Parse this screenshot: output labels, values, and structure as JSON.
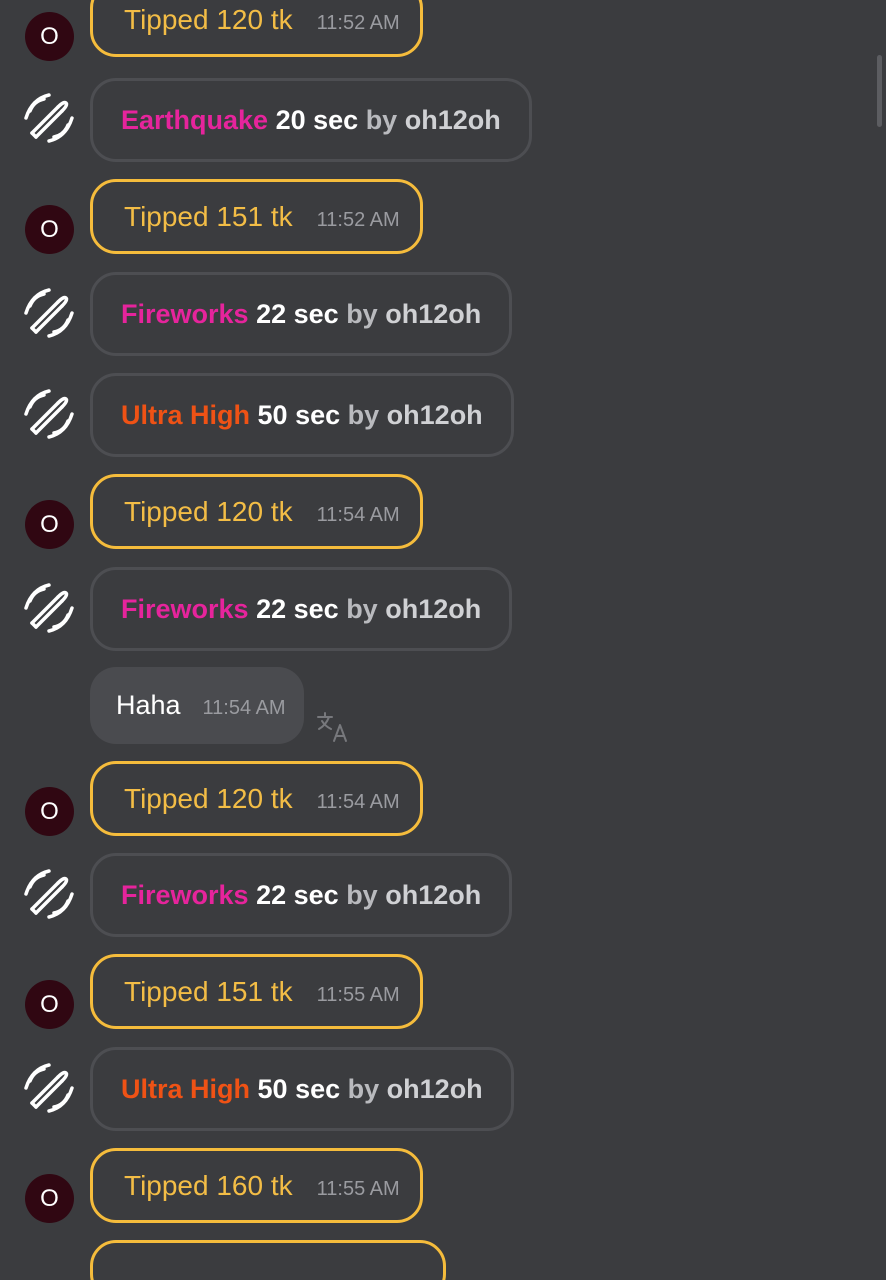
{
  "avatar_letter": "O",
  "messages": [
    {
      "tip": "Tipped 120 tk",
      "time": "11:52 AM"
    },
    {
      "effect": "Earthquake",
      "duration": "20 sec",
      "by": "by",
      "user": "oh12oh"
    },
    {
      "tip": "Tipped 151 tk",
      "time": "11:52 AM"
    },
    {
      "effect": "Fireworks",
      "duration": "22 sec",
      "by": "by",
      "user": "oh12oh"
    },
    {
      "effect": "Ultra High",
      "duration": "50 sec",
      "by": "by",
      "user": "oh12oh"
    },
    {
      "tip": "Tipped 120 tk",
      "time": "11:54 AM"
    },
    {
      "effect": "Fireworks",
      "duration": "22 sec",
      "by": "by",
      "user": "oh12oh"
    },
    {
      "text": "Haha",
      "time": "11:54 AM"
    },
    {
      "tip": "Tipped 120 tk",
      "time": "11:54 AM"
    },
    {
      "effect": "Fireworks",
      "duration": "22 sec",
      "by": "by",
      "user": "oh12oh"
    },
    {
      "tip": "Tipped 151 tk",
      "time": "11:55 AM"
    },
    {
      "effect": "Ultra High",
      "duration": "50 sec",
      "by": "by",
      "user": "oh12oh"
    },
    {
      "tip": "Tipped 160 tk",
      "time": "11:55 AM"
    }
  ],
  "icons": {
    "vibration": "vibration-toy-icon",
    "translate": "translate-icon"
  },
  "colors": {
    "background": "#3b3c3f",
    "tip_border": "#f5bc3c",
    "tip_text": "#f3bd46",
    "effect_pink": "#e6249c",
    "effect_orange": "#ef5215",
    "avatar_bg": "#300712"
  }
}
